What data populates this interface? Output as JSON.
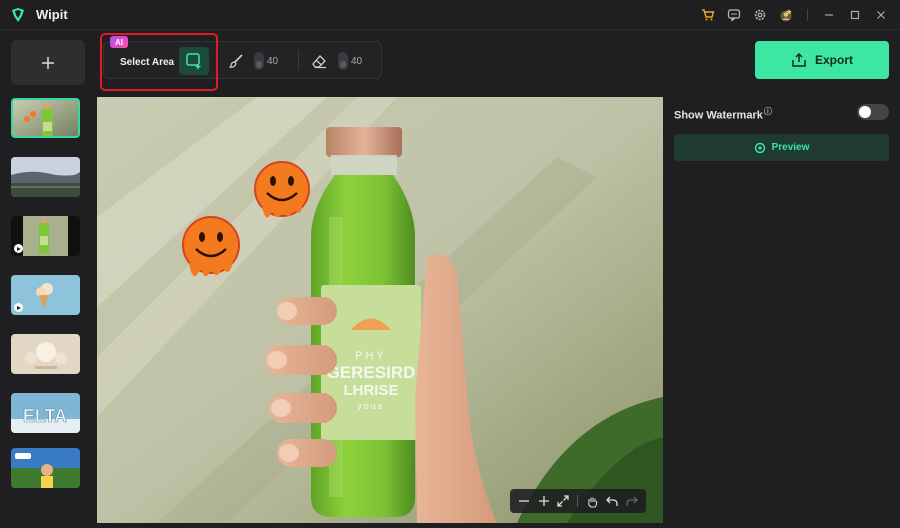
{
  "app": {
    "title": "Wipit"
  },
  "toolbar": {
    "ai_badge": "AI",
    "select_area_label": "Select Area",
    "brush_value": "40",
    "eraser_value": "40",
    "export_label": "Export"
  },
  "right_panel": {
    "show_watermark_label": "Show Watermark",
    "info_glyph": "ⓘ",
    "watermark_on": false,
    "preview_label": "Preview"
  },
  "product": {
    "label_line1": "PHY",
    "label_line2": "GERESIRD",
    "label_line3": "LHRISE",
    "label_line4": "youe"
  },
  "colors": {
    "accent": "#3ee6a4",
    "highlight_border": "#e11d24",
    "background": "#1f1f21"
  },
  "icons": {
    "add": "plus-icon",
    "select": "select-area-icon",
    "brush": "brush-icon",
    "eraser": "eraser-icon",
    "export": "export-icon",
    "preview": "eye-icon"
  }
}
